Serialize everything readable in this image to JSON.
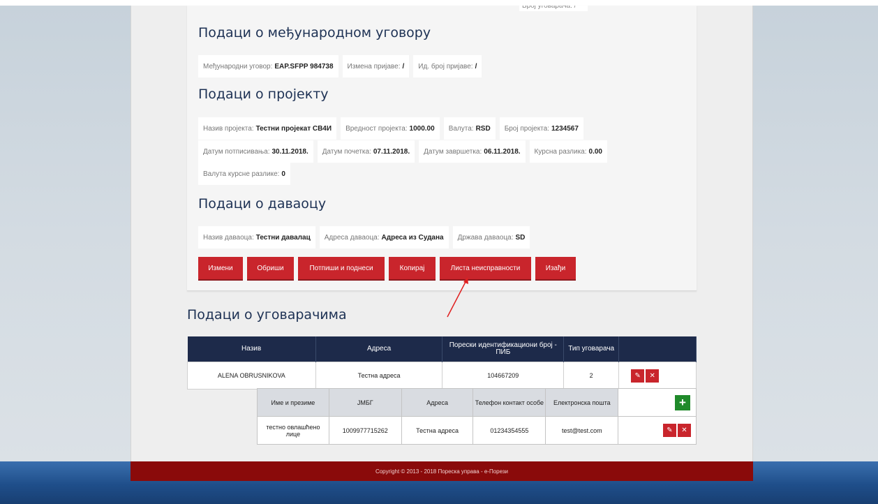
{
  "top_snippet": "Број уговарача: /",
  "sections": {
    "international_title": "Подаци о међународном уговору",
    "project_title": "Подаци о пројекту",
    "donor_title": "Подаци о даваоцу",
    "contractors_title": "Подаци о уговарачима"
  },
  "international": [
    {
      "label": "Међународни уговор:",
      "value": "EAP.SFPP 984738"
    },
    {
      "label": "Измена пријаве:",
      "value": "/"
    },
    {
      "label": "Ид. број пријаве:",
      "value": "/"
    }
  ],
  "project_row1": [
    {
      "label": "Назив пројекта:",
      "value": "Тестни пројекат СВ4И"
    },
    {
      "label": "Вредност пројекта:",
      "value": "1000.00"
    },
    {
      "label": "Валута:",
      "value": "RSD"
    },
    {
      "label": "Број пројекта:",
      "value": "1234567"
    }
  ],
  "project_row2": [
    {
      "label": "Датум потписивања:",
      "value": "30.11.2018."
    },
    {
      "label": "Датум почетка:",
      "value": "07.11.2018."
    },
    {
      "label": "Датум завршетка:",
      "value": "06.11.2018."
    },
    {
      "label": "Курсна разлика:",
      "value": "0.00"
    }
  ],
  "project_row3": [
    {
      "label": "Валута курсне разлике:",
      "value": "0"
    }
  ],
  "donor": [
    {
      "label": "Назив даваоца:",
      "value": "Тестни давалац"
    },
    {
      "label": "Адреса даваоца:",
      "value": "Адреса из Судана"
    },
    {
      "label": "Држава даваоца:",
      "value": "SD"
    }
  ],
  "buttons": [
    "Измени",
    "Обриши",
    "Потпиши и поднеси",
    "Копирај",
    "Листа неисправности",
    "Изађи"
  ],
  "contractors_table": {
    "headers": [
      "Назив",
      "Адреса",
      "Порески идентификациони број - ПИБ",
      "Тип уговарача"
    ],
    "rows": [
      [
        "ALENA OBRUSNIKOVA",
        "Тестна адреса",
        "104667209",
        "2"
      ]
    ]
  },
  "persons_table": {
    "headers": [
      "Име и презиме",
      "ЈМБГ",
      "Адреса",
      "Телефон контакт особе",
      "Електронска пошта"
    ],
    "rows": [
      [
        "тестно овлашћено лице",
        "1009977715262",
        "Тестна адреса",
        "01234354555",
        "test@test.com"
      ]
    ]
  },
  "icons": {
    "edit": "pencil-icon",
    "delete": "close-icon",
    "add": "plus-icon"
  },
  "footer": "Copyright © 2013 - 2018 Пореска управа - е-Порези",
  "colors": {
    "accent_red": "#c9252c",
    "header_navy": "#1d2a4a",
    "add_green": "#1f8a2a",
    "footer_red": "#8a0a0a"
  }
}
